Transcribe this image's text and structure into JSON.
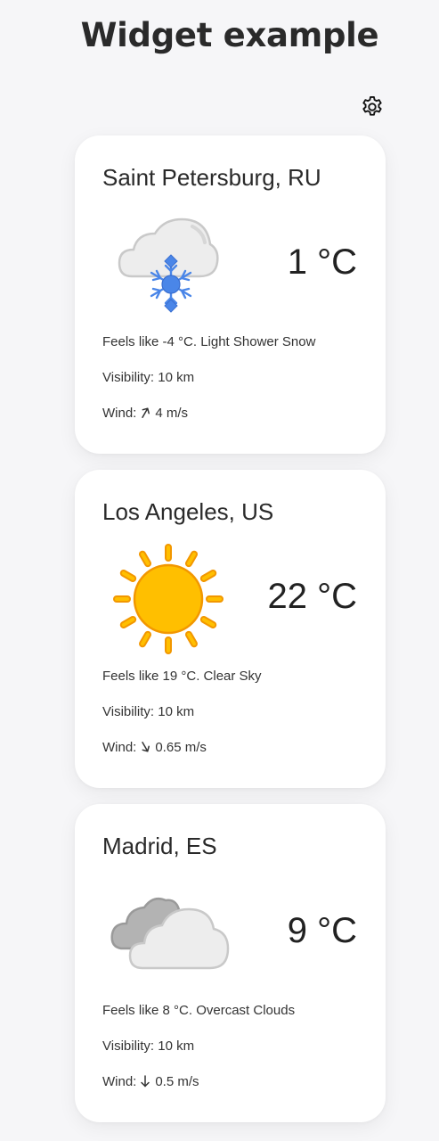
{
  "page": {
    "title": "Widget example"
  },
  "settings": {
    "icon": "gear-icon"
  },
  "cards": [
    {
      "city": "Saint Petersburg, RU",
      "icon": "snow-cloud-icon",
      "temperature": "1 °C",
      "feels": "Feels like -4 °C. Light Shower Snow",
      "visibility": "Visibility: 10 km",
      "wind_label": "Wind:",
      "wind_value": "4 m/s",
      "wind_direction_deg": 30
    },
    {
      "city": "Los Angeles, US",
      "icon": "sun-icon",
      "temperature": "22 °C",
      "feels": "Feels like 19 °C. Clear Sky",
      "visibility": "Visibility: 10 km",
      "wind_label": "Wind:",
      "wind_value": "0.65 m/s",
      "wind_direction_deg": 150
    },
    {
      "city": "Madrid, ES",
      "icon": "overcast-clouds-icon",
      "temperature": "9 °C",
      "feels": "Feels like 8 °C. Overcast Clouds",
      "visibility": "Visibility: 10 km",
      "wind_label": "Wind:",
      "wind_value": "0.5 m/s",
      "wind_direction_deg": 180
    }
  ],
  "colors": {
    "background": "#f6f6f8",
    "card": "#ffffff",
    "snow_blue": "#4a86e8",
    "sun_yellow": "#ffbf00",
    "sun_orange": "#f29700",
    "cloud_grey": "#c8c8c8"
  }
}
